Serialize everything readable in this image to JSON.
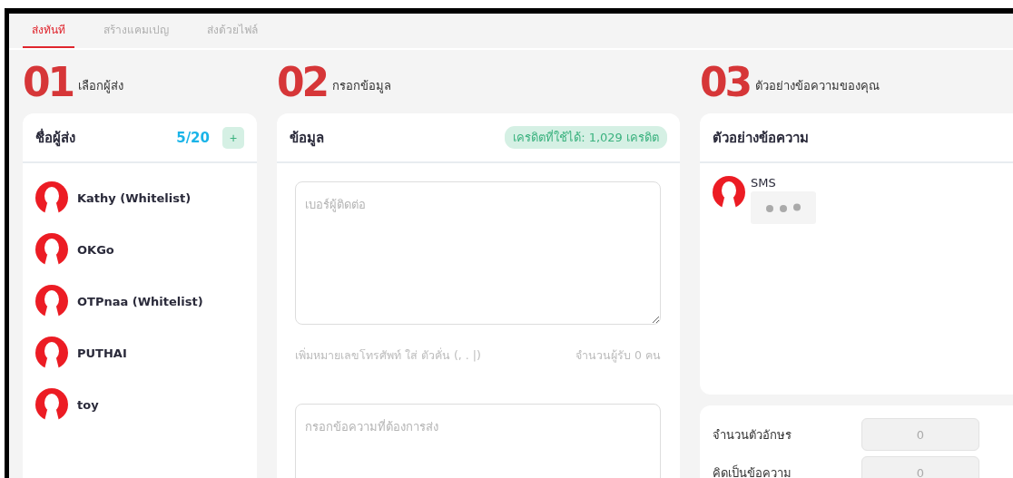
{
  "tabs": [
    {
      "label": "ส่งทันที",
      "selected": true
    },
    {
      "label": "สร้างแคมเปญ",
      "selected": false
    },
    {
      "label": "ส่งด้วยไฟล์",
      "selected": false
    }
  ],
  "steps": [
    {
      "number": "01",
      "title": "เลือกผู้ส่ง"
    },
    {
      "number": "02",
      "title": "กรอกข้อมูล"
    },
    {
      "number": "03",
      "title": "ตัวอย่างข้อความของคุณ"
    }
  ],
  "senders": {
    "title": "ชื่อผู้ส่ง",
    "count": "5/20",
    "add_label": "+",
    "items": [
      {
        "name": "Kathy (Whitelist)"
      },
      {
        "name": "OKGo"
      },
      {
        "name": "OTPnaa (Whitelist)"
      },
      {
        "name": "PUTHAI"
      },
      {
        "name": "toy"
      }
    ]
  },
  "info": {
    "title": "ข้อมูล",
    "credit_badge": "เครดิตที่ใช้ได้: 1,029 เครดิต",
    "phone_placeholder": "เบอร์ผู้ติดต่อ",
    "phone_hint": "เพิ่มหมายเลขโทรศัพท์ ใส่ ตัวคั่น (, . |)",
    "recipient_count": "จำนวนผู้รับ 0 คน",
    "message_placeholder": "กรอกข้อความที่ต้องการส่ง"
  },
  "preview": {
    "title": "ตัวอย่างข้อความ",
    "sender": "SMS"
  },
  "stats": [
    {
      "label": "จำนวนตัวอักษร",
      "value": "0"
    },
    {
      "label": "คิดเป็นข้อความ",
      "value": "0"
    }
  ]
}
